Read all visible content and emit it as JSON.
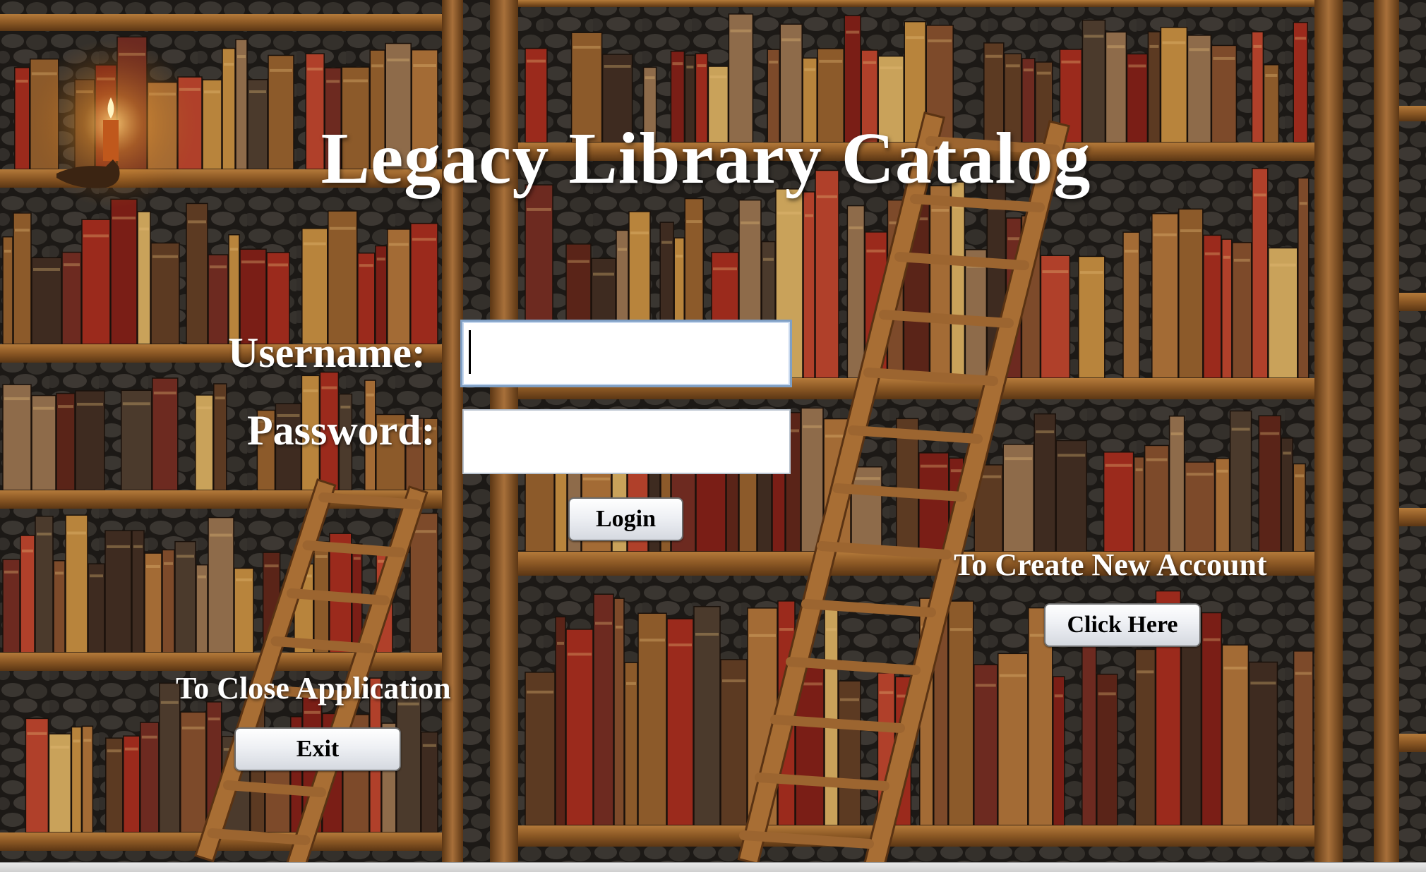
{
  "app": {
    "title": "Legacy Library Catalog"
  },
  "login_form": {
    "username_label": "Username:",
    "username_value": "",
    "password_label": "Password:",
    "password_value": "",
    "login_button": "Login"
  },
  "create_account": {
    "prompt": "To Create New Account",
    "button": "Click Here"
  },
  "close_app": {
    "prompt": "To Close Application",
    "button": "Exit"
  },
  "colors": {
    "text": "#ffffff",
    "shelf_wood": "#8a5a25",
    "stone_wall": "#2a2724",
    "button_face": "#eef0f4"
  }
}
